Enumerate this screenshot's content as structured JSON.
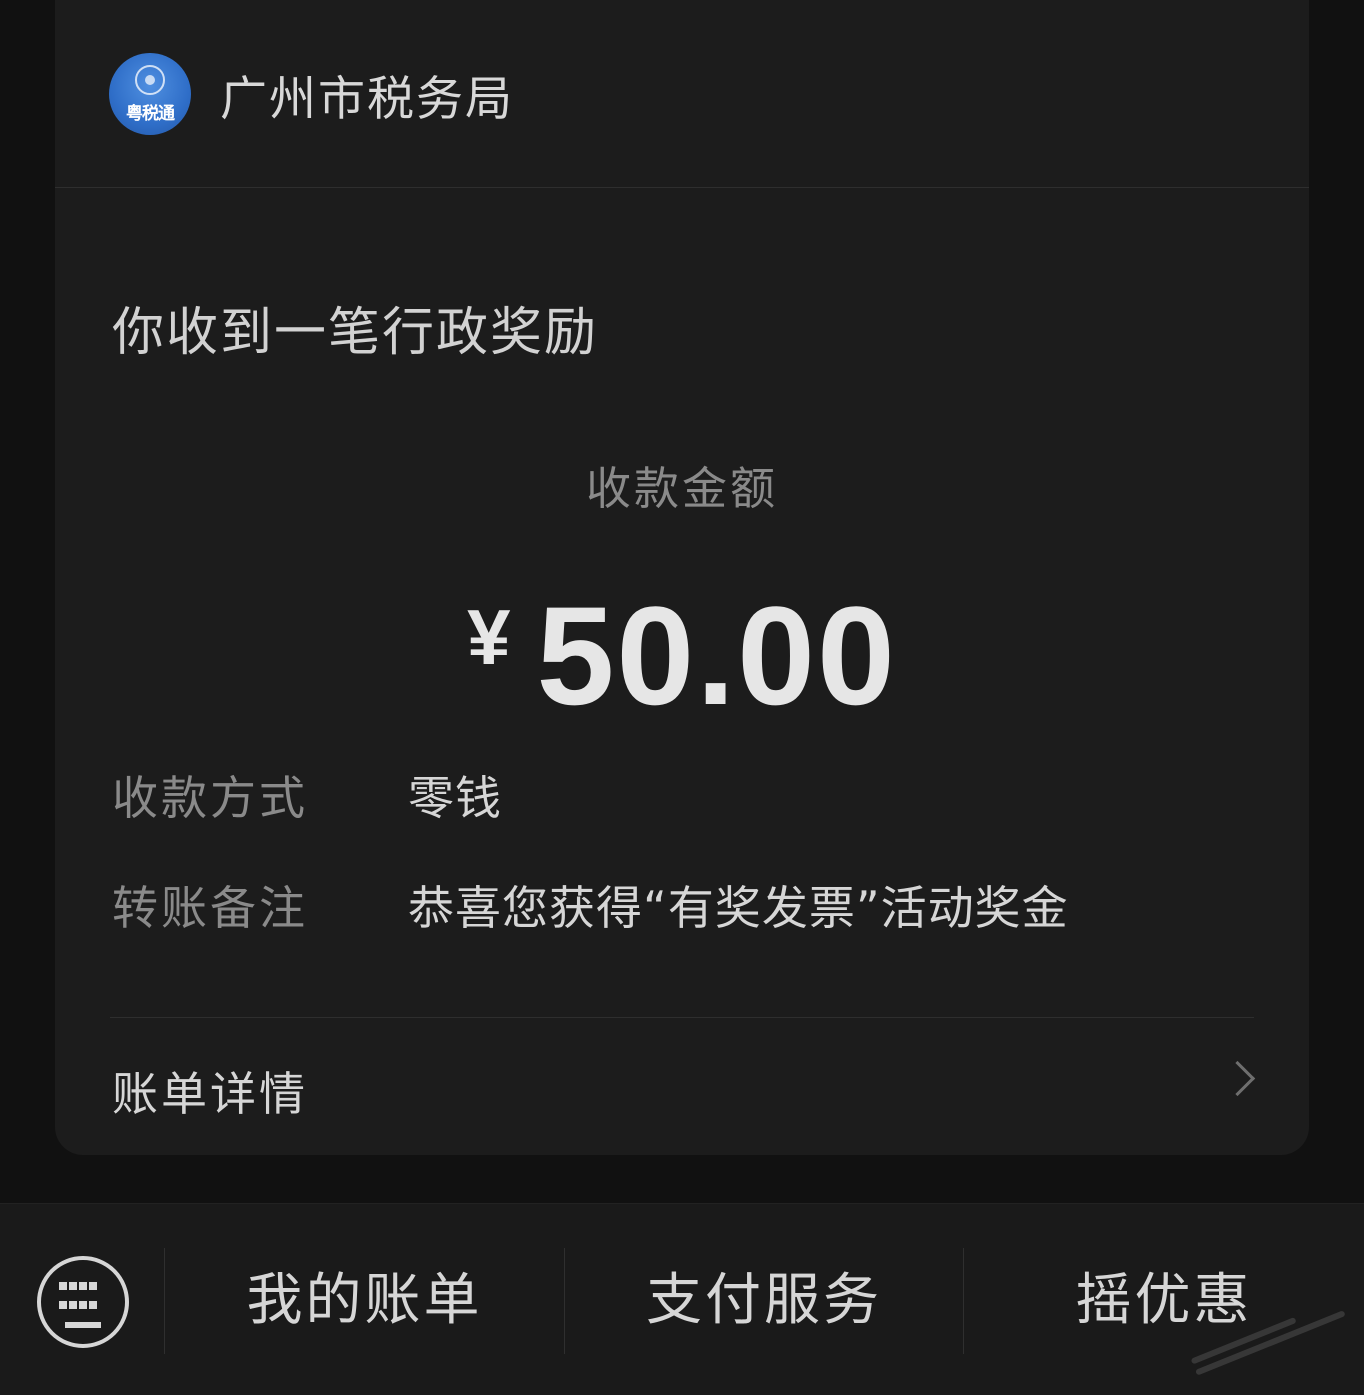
{
  "header": {
    "org_name": "广州市税务局",
    "avatar_text": "粤税通",
    "avatar_color": "#2f6ec8"
  },
  "card": {
    "title": "你收到一笔行政奖励",
    "amount_label": "收款金额",
    "currency_symbol": "¥",
    "amount": "50.00"
  },
  "details": [
    {
      "key": "收款方式",
      "value": "零钱"
    },
    {
      "key": "转账备注",
      "value": "恭喜您获得“有奖发票”活动奖金"
    }
  ],
  "bill_link": {
    "label": "账单详情",
    "icon": "chevron-right-icon"
  },
  "bottom_bar": {
    "keyboard_icon": "keyboard-icon",
    "items": [
      {
        "label": "我的账单"
      },
      {
        "label": "支付服务"
      },
      {
        "label": "摇优惠"
      }
    ]
  }
}
